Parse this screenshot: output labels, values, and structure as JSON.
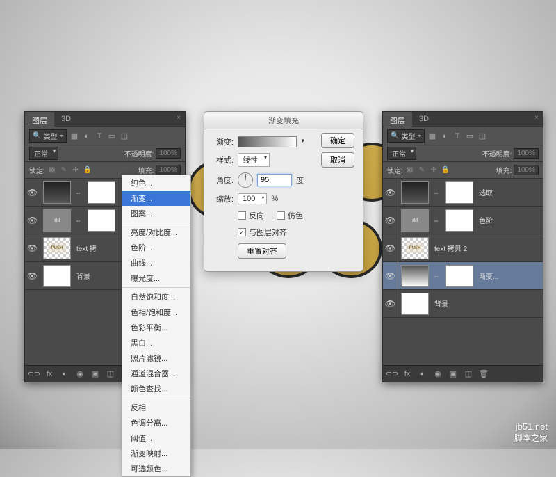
{
  "tabs": {
    "layers": "图层",
    "threeD": "3D"
  },
  "filter": {
    "type": "类型"
  },
  "blend": {
    "mode": "正常",
    "opacityLabel": "不透明度:",
    "opacityVal": "100%"
  },
  "lock": {
    "label": "锁定:",
    "fillLabel": "填充:",
    "fillVal": "100%"
  },
  "layersL": {
    "l1": "",
    "l2": "",
    "l3": "text 拷",
    "l4": "背景"
  },
  "layersR": {
    "l1": "选取",
    "l2": "色阶",
    "l3": "text 拷贝 2",
    "l4": "渐变...",
    "l5": "背景"
  },
  "ctx": {
    "solid": "纯色...",
    "gradient": "渐变...",
    "pattern": "图案...",
    "bc": "亮度/对比度...",
    "levels": "色阶...",
    "curves": "曲线...",
    "exposure": "曝光度...",
    "vibrance": "自然饱和度...",
    "hsl": "色相/饱和度...",
    "colorbal": "色彩平衡...",
    "bw": "黑白...",
    "photof": "照片滤镜...",
    "chmix": "通道混合器...",
    "clookup": "颜色查找...",
    "invert": "反相",
    "poster": "色调分离...",
    "threshold": "阈值...",
    "gradmap": "渐变映射...",
    "selcolor": "可选颜色..."
  },
  "dialog": {
    "title": "渐变填充",
    "gradLabel": "渐变:",
    "styleLabel": "样式:",
    "styleVal": "线性",
    "angleLabel": "角度:",
    "angleVal": "95",
    "angleUnit": "度",
    "scaleLabel": "缩放:",
    "scaleVal": "100",
    "scaleUnit": "%",
    "reverse": "反向",
    "dither": "仿色",
    "alignLayer": "与图层对齐",
    "resetAlign": "重置对齐",
    "ok": "确定",
    "cancel": "取消"
  },
  "watermark": {
    "url": "jb51.net",
    "name": "脚本之家"
  }
}
